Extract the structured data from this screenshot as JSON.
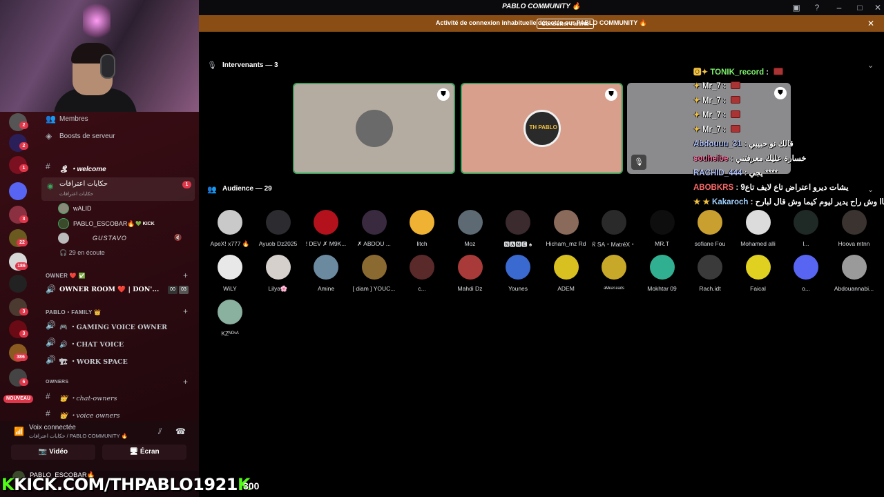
{
  "window": {
    "title": "PABLO COMMUNITY 🔥",
    "controls": [
      "inbox-icon",
      "help-icon",
      "minimize-icon",
      "maximize-icon",
      "close-icon"
    ]
  },
  "alert": {
    "text": "Activité de connexion inhabituelle détectée sur PABLO COMMUNITY 🔥",
    "button": "Consulter l'alerte",
    "close": "✕"
  },
  "sidebar": {
    "top_items": [
      {
        "label": "Membres",
        "icon": "members-icon"
      },
      {
        "label": "Boosts de serveur",
        "icon": "boost-icon"
      }
    ],
    "channels_top": [
      {
        "name": "🏝 ・welcome",
        "type": "text"
      },
      {
        "name": "حكايات اعترافات",
        "sub": "حكايات اعترافات",
        "type": "voice",
        "badge": "1"
      }
    ],
    "voice_users": [
      {
        "name": "wALID"
      },
      {
        "name": "PABLO_ESCOBAR🔥",
        "tag": "💚 KICK"
      },
      {
        "name": "GUSTAVO"
      }
    ],
    "listening": "29 en écoute",
    "owner_category": "OWNER ❤️ ✅",
    "owner_room": {
      "name": "OWNER ROOM ❤️ | DON'...",
      "c1": "00",
      "c2": "03"
    },
    "pablo_category": "PABLO・FAMILY 👑",
    "pablo_channels": [
      "🎮 ・GAMING VOICE OWNER",
      "🔊 ・CHAT VOICE",
      "🏗 ・WORK SPACE"
    ],
    "owners_category": "OWNERS",
    "owners_channels": [
      "👑 ・chat-owners",
      "👑 ・voice owners"
    ],
    "server_badges": [
      "2",
      "2",
      "1",
      "3",
      "22",
      "186",
      "3",
      "3",
      "386",
      "6"
    ],
    "new_badge": "NOUVEAU"
  },
  "voice_panel": {
    "status": "Voix connectée",
    "location": "حكايات اعترافات / PABLO COMMUNITY 🔥",
    "video": "Vidéo",
    "screen": "Écran"
  },
  "userbar": {
    "name": "PABLO_ESCOBAR🔥"
  },
  "stream_overlay": {
    "kick": "KICK.COM/THPABLO1921",
    "count": "300"
  },
  "stage": {
    "speakers_title": "Intervenants — 3",
    "audience_title": "Audience — 29",
    "speakers": [
      {
        "name": "speaker-1",
        "bg": "#b5aca1"
      },
      {
        "name": "speaker-2",
        "bg": "#d79f8c",
        "label": "TH PABLO"
      },
      {
        "name": "speaker-3",
        "bg": "#8b8b8d"
      }
    ],
    "audience": [
      {
        "name": "ApeX! x777 🔥",
        "color": "#c9c9c9"
      },
      {
        "name": "Ayuob Dz2025",
        "color": "#2b2b30"
      },
      {
        "name": "! DEV ✗ M9K...",
        "color": "#b3121d"
      },
      {
        "name": "✗ ABDOU ...",
        "color": "#3a2a40"
      },
      {
        "name": "litch",
        "color": "#f0b232"
      },
      {
        "name": "Moz",
        "color": "#5d6a74"
      },
      {
        "name": "🅽🅰🅼🅴 ♠",
        "color": "#3b2a2e"
      },
      {
        "name": "Hicham_mz Rd",
        "color": "#8a6a5a"
      },
      {
        "name": "ᖇ SA・MatréX・",
        "color": "#2a2a2a"
      },
      {
        "name": "MR.T",
        "color": "#0e0e0e"
      },
      {
        "name": "sofiane Fou",
        "color": "#c9a030"
      },
      {
        "name": "Mohamed alli",
        "color": "#dcdcdc"
      },
      {
        "name": "l...",
        "color": "#1f2a26"
      },
      {
        "name": "Hoova mtnn",
        "color": "#3a3330"
      },
      {
        "name": "WiLY",
        "color": "#e8e8e8"
      },
      {
        "name": "Lilya🌸",
        "color": "#d6d0cc"
      },
      {
        "name": "Amine",
        "color": "#6b8aa0"
      },
      {
        "name": "[ diam ] YOUC...",
        "color": "#8a6a30"
      },
      {
        "name": "c...",
        "color": "#5a2a2a"
      },
      {
        "name": "Mahdi Dz",
        "color": "#a83a3a"
      },
      {
        "name": "Younes",
        "color": "#3a6ad0"
      },
      {
        "name": "ADEM",
        "color": "#d8c020"
      },
      {
        "name": "ᵃᴹᵉᵃ⁵ᵉᵃᵈˢ",
        "color": "#c8a828"
      },
      {
        "name": "Mokhtar 09",
        "color": "#30b090"
      },
      {
        "name": "Rach.idt",
        "color": "#3a3a3a"
      },
      {
        "name": "Faical",
        "color": "#e0d020"
      },
      {
        "name": "o...",
        "color": "#5865f2"
      },
      {
        "name": "Abdouannabi...",
        "color": "#9a9a9a"
      },
      {
        "name": "KZᴺᴼᵛᴬ",
        "color": "#8ab0a0"
      }
    ]
  },
  "chat": [
    {
      "user": "TONIK_record",
      "msg": "",
      "color": "#7cf26b",
      "emote": true,
      "prefix": "🅾✦"
    },
    {
      "user": "Mr_7",
      "msg": "",
      "color": "#ffffff",
      "emote": true,
      "prefix": "✦"
    },
    {
      "user": "Mr_7",
      "msg": "",
      "color": "#ffffff",
      "emote": true,
      "prefix": "✦"
    },
    {
      "user": "Mr_7",
      "msg": "",
      "color": "#ffffff",
      "emote": true,
      "prefix": "✦"
    },
    {
      "user": "Mr_7",
      "msg": "",
      "color": "#ffffff",
      "emote": true,
      "prefix": "✦"
    },
    {
      "user": "Abdouuu_31",
      "msg": "قالك نو حبيبي",
      "color": "#b5c6ff",
      "emote": false,
      "prefix": ""
    },
    {
      "user": "souheibe",
      "msg": "خسارة عليك معرفتني",
      "color": "#ff6b9d",
      "emote": false,
      "prefix": ""
    },
    {
      "user": "RACHID_444",
      "msg": "يجي ****",
      "color": "#b5c6ff",
      "emote": false,
      "prefix": ""
    },
    {
      "user": "ABOBKRS",
      "msg": "يشات ديرو اعتراض تاع لايف تاع9",
      "color": "#ff6b6b",
      "emote": false,
      "prefix": ""
    },
    {
      "user": "Kakaroch",
      "msg": "هوقاا وش راح يدير ليوم كيما وش قال لبارح",
      "color": "#9fd0ff",
      "emote": false,
      "prefix": "★ ★"
    }
  ]
}
